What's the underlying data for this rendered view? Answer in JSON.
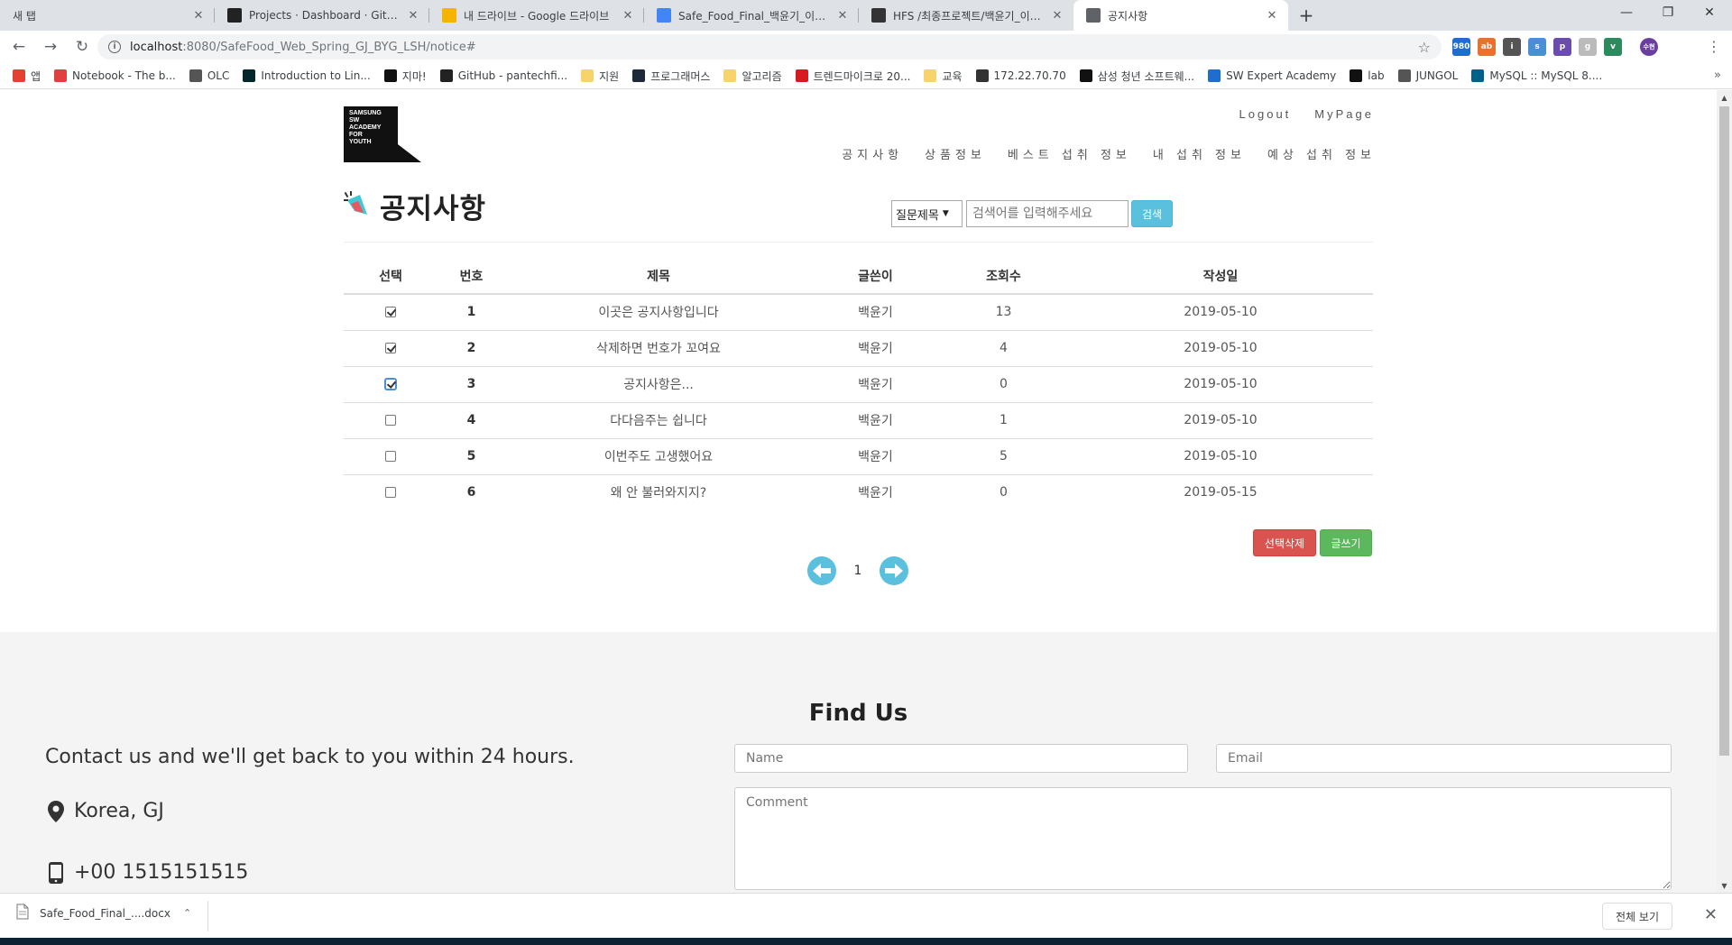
{
  "browser": {
    "tabs": [
      {
        "title": "새 탭",
        "favicon": "none",
        "color": "#dee1e6"
      },
      {
        "title": "Projects · Dashboard · GitLab",
        "favicon": "ssafy-icon",
        "color": "#222222"
      },
      {
        "title": "내 드라이브 - Google 드라이브",
        "favicon": "google-drive-icon",
        "color": "#f4b400"
      },
      {
        "title": "Safe_Food_Final_백윤기_이수현...",
        "favicon": "google-docs-icon",
        "color": "#4285f4"
      },
      {
        "title": "HFS /최종프로젝트/백윤기_이수...",
        "favicon": "hfs-icon",
        "color": "#333333"
      },
      {
        "title": "공지사항",
        "favicon": "globe-icon",
        "color": "#5f6368"
      }
    ],
    "url_host": "localhost",
    "url_path": ":8080/SafeFood_Web_Spring_GJ_BYG_LSH/notice#",
    "bookmarks": [
      {
        "label": "앱",
        "icon": "apps-grid-icon",
        "color": "#e44134"
      },
      {
        "label": "Notebook - The b...",
        "icon": "shield-icon",
        "color": "#e04040"
      },
      {
        "label": "OLC",
        "icon": "globe-icon",
        "color": "#555555"
      },
      {
        "label": "Introduction to Lin...",
        "icon": "edx-icon",
        "color": "#02262b"
      },
      {
        "label": "지마!",
        "icon": "up-icon",
        "color": "#111111"
      },
      {
        "label": "GitHub - pantechfi...",
        "icon": "github-icon",
        "color": "#222222"
      },
      {
        "label": "지원",
        "icon": "folder-icon",
        "color": "#f6d46b"
      },
      {
        "label": "프로그래머스",
        "icon": "programmers-icon",
        "color": "#1e2a3a"
      },
      {
        "label": "알고리즘",
        "icon": "folder-icon",
        "color": "#f6d46b"
      },
      {
        "label": "트렌드마이크로 20...",
        "icon": "trendmicro-icon",
        "color": "#d71920"
      },
      {
        "label": "교육",
        "icon": "folder-icon",
        "color": "#f6d46b"
      },
      {
        "label": "172.22.70.70",
        "icon": "hfs-icon",
        "color": "#333333"
      },
      {
        "label": "삼성 청년 소프트웨...",
        "icon": "ssafy-icon",
        "color": "#111111"
      },
      {
        "label": "SW Expert Academy",
        "icon": "swea-icon",
        "color": "#1f6dd1"
      },
      {
        "label": "lab",
        "icon": "ssafy-icon",
        "color": "#111111"
      },
      {
        "label": "JUNGOL",
        "icon": "globe-icon",
        "color": "#555555"
      },
      {
        "label": "MySQL :: MySQL 8....",
        "icon": "mysql-icon",
        "color": "#00618a"
      }
    ],
    "extensions": [
      "980",
      "ab",
      "i",
      "s",
      "p",
      "g",
      "v"
    ],
    "profile_initial": "수현"
  },
  "site": {
    "logo_text": "SAMSUNG\nSW\nACADEMY\nFOR\nYOUTH",
    "top_links": [
      "Logout",
      "MyPage"
    ],
    "nav": [
      "공지사항",
      "상품정보",
      "베스트 섭취 정보",
      "내 섭취 정보",
      "예상 섭취 정보"
    ]
  },
  "notice": {
    "title": "공지사항",
    "search": {
      "select_value": "질문제목",
      "placeholder": "검색어를 입력해주세요",
      "button": "검색"
    },
    "columns": [
      "선택",
      "번호",
      "제목",
      "글쓴이",
      "조회수",
      "작성일"
    ],
    "rows": [
      {
        "checked": true,
        "num": "1",
        "title": "이곳은 공지사항입니다",
        "author": "백윤기",
        "views": "13",
        "date": "2019-05-10"
      },
      {
        "checked": true,
        "num": "2",
        "title": "삭제하면 번호가 꼬여요",
        "author": "백윤기",
        "views": "4",
        "date": "2019-05-10"
      },
      {
        "checked": true,
        "num": "3",
        "title": "공지사항은...",
        "author": "백윤기",
        "views": "0",
        "date": "2019-05-10"
      },
      {
        "checked": false,
        "num": "4",
        "title": "다다음주는 쉽니다",
        "author": "백윤기",
        "views": "1",
        "date": "2019-05-10"
      },
      {
        "checked": false,
        "num": "5",
        "title": "이번주도 고생했어요",
        "author": "백윤기",
        "views": "5",
        "date": "2019-05-10"
      },
      {
        "checked": false,
        "num": "6",
        "title": "왜 안 불러와지지?",
        "author": "백윤기",
        "views": "0",
        "date": "2019-05-15"
      }
    ],
    "delete_button": "선택삭제",
    "write_button": "글쓰기",
    "current_page": "1"
  },
  "footer": {
    "heading": "Find Us",
    "contact_text": "Contact us and we'll get back to you within 24 hours.",
    "location": "Korea, GJ",
    "phone": "+00 1515151515",
    "name_placeholder": "Name",
    "email_placeholder": "Email",
    "comment_placeholder": "Comment"
  },
  "downloads": {
    "file": "Safe_Food_Final_....docx",
    "show_all": "전체 보기"
  }
}
